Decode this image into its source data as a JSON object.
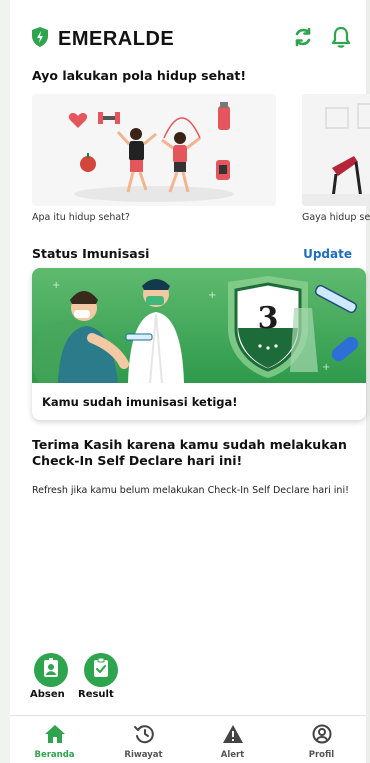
{
  "app": {
    "brand": "EMERALDE"
  },
  "colors": {
    "primary": "#2fa44f",
    "link": "#1e6ebd",
    "text": "#111111"
  },
  "header": {
    "icons": [
      "sync-icon",
      "bell-icon"
    ]
  },
  "lifestyle": {
    "title": "Ayo lakukan pola hidup sehat!",
    "cards": [
      {
        "caption": "Apa itu hidup sehat?"
      },
      {
        "caption": "Gaya hidup sehat"
      }
    ]
  },
  "immunization": {
    "title": "Status Imunisasi",
    "update_label": "Update",
    "dose_number": "3",
    "message": "Kamu sudah imunisasi ketiga!"
  },
  "checkin": {
    "thanks": "Terima Kasih karena kamu sudah melakukan Check-In Self Declare hari ini!",
    "refresh": "Refresh jika kamu belum melakukan Check-In Self Declare hari ini!"
  },
  "actions": [
    {
      "label": "Absen",
      "icon": "badge-icon"
    },
    {
      "label": "Result",
      "icon": "clipboard-check-icon"
    }
  ],
  "nav": [
    {
      "label": "Beranda",
      "icon": "home-icon",
      "active": true
    },
    {
      "label": "Riwayat",
      "icon": "history-icon",
      "active": false
    },
    {
      "label": "Alert",
      "icon": "alert-icon",
      "active": false
    },
    {
      "label": "Profil",
      "icon": "profile-icon",
      "active": false
    }
  ]
}
